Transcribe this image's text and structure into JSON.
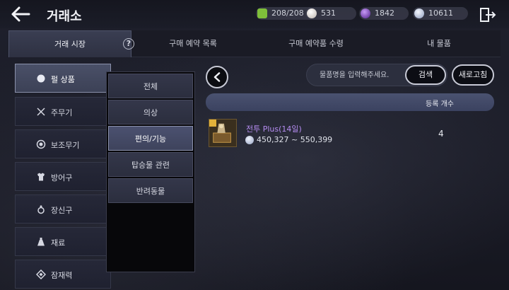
{
  "header": {
    "title": "거래소",
    "currencies": [
      {
        "icon": "cube-icon",
        "value": "208/208",
        "color": "#7fbf3a"
      },
      {
        "icon": "pearl-icon",
        "value": "531",
        "color": "#e8e2de"
      },
      {
        "icon": "purple-orb-icon",
        "value": "1842",
        "color": "#7a3cc8"
      },
      {
        "icon": "silver-coin-icon",
        "value": "10611",
        "color": "#c9d4ec"
      }
    ]
  },
  "tabs": [
    {
      "label": "거래 시장",
      "active": true
    },
    {
      "label": "구매 예약 목록",
      "active": false
    },
    {
      "label": "구매 예약품 수령",
      "active": false
    },
    {
      "label": "내 물품",
      "active": false
    }
  ],
  "help": "?",
  "categories": [
    {
      "label": "펄 상품",
      "icon": "pearl-category-icon",
      "active": true
    },
    {
      "label": "주무기",
      "icon": "crossed-swords-icon",
      "active": false
    },
    {
      "label": "보조무기",
      "icon": "shield-ring-icon",
      "active": false
    },
    {
      "label": "방어구",
      "icon": "armor-icon",
      "active": false
    },
    {
      "label": "장신구",
      "icon": "ring-icon",
      "active": false
    },
    {
      "label": "재료",
      "icon": "potion-icon",
      "active": false
    },
    {
      "label": "잠재력",
      "icon": "diamond-icon",
      "active": false
    }
  ],
  "submenu": [
    {
      "label": "전체",
      "active": false
    },
    {
      "label": "의상",
      "active": false
    },
    {
      "label": "편의/기능",
      "active": true
    },
    {
      "label": "탑승물 관련",
      "active": false
    },
    {
      "label": "반려동물",
      "active": false
    }
  ],
  "search": {
    "placeholder": "물품명을 입력해주세요.",
    "button": "검색",
    "refresh": "새로고침"
  },
  "results": {
    "column_count": "등록 개수",
    "items": [
      {
        "name": "전투 Plus(14일)",
        "price": "450,327 ~ 550,399",
        "count": "4"
      }
    ]
  },
  "colors": {
    "accent": "#4a5270",
    "item_purple": "#b58cf0"
  }
}
